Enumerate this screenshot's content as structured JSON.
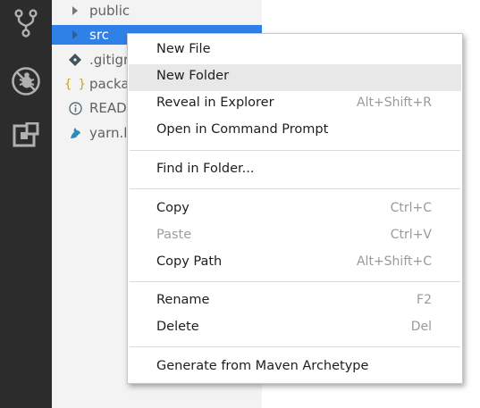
{
  "activity_bar": {
    "icons": [
      "source-control-icon",
      "debug-icon",
      "extensions-icon"
    ]
  },
  "explorer": {
    "items": [
      {
        "label": "public",
        "icon": "chevron-right-icon"
      },
      {
        "label": "src",
        "icon": "chevron-right-icon",
        "selected": true
      },
      {
        "label": ".gitignore",
        "visible_label": ".gitigr",
        "icon": "git-file-icon"
      },
      {
        "label": "package.json",
        "visible_label": "packa",
        "icon": "json-braces-icon"
      },
      {
        "label": "README",
        "visible_label": "READ",
        "icon": "info-icon"
      },
      {
        "label": "yarn.lock",
        "visible_label": "yarn.lo",
        "icon": "yarn-icon"
      }
    ]
  },
  "context_menu": {
    "items": [
      {
        "label": "New File",
        "shortcut": ""
      },
      {
        "label": "New Folder",
        "shortcut": "",
        "highlighted": true
      },
      {
        "label": "Reveal in Explorer",
        "shortcut": "Alt+Shift+R"
      },
      {
        "label": "Open in Command Prompt",
        "shortcut": ""
      },
      {
        "label": "Find in Folder...",
        "shortcut": ""
      },
      {
        "label": "Copy",
        "shortcut": "Ctrl+C"
      },
      {
        "label": "Paste",
        "shortcut": "Ctrl+V",
        "disabled": true
      },
      {
        "label": "Copy Path",
        "shortcut": "Alt+Shift+C"
      },
      {
        "label": "Rename",
        "shortcut": "F2"
      },
      {
        "label": "Delete",
        "shortcut": "Del"
      },
      {
        "label": "Generate from Maven Archetype",
        "shortcut": ""
      }
    ]
  },
  "colors": {
    "activity_bar_bg": "#2c2c2c",
    "sidebar_bg": "#f3f3f3",
    "selection_bg": "#2f80e7",
    "menu_highlight": "#e8e8e8"
  }
}
